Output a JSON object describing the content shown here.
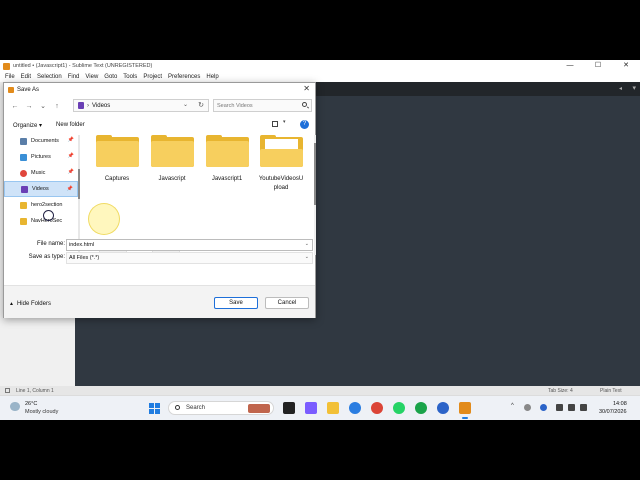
{
  "window": {
    "title": "untitled • (Javascript1) - Sublime Text (UNREGISTERED)",
    "minimize": "—",
    "maximize": "☐",
    "close": "✕"
  },
  "menu": [
    "File",
    "Edit",
    "Selection",
    "Find",
    "View",
    "Goto",
    "Tools",
    "Project",
    "Preferences",
    "Help"
  ],
  "tabbar": {
    "arrow": "◂",
    "menu": "▾"
  },
  "statusbar": {
    "position": "Line 1, Column 1",
    "tab_size": "Tab Size: 4",
    "syntax": "Plain Text"
  },
  "dialog": {
    "title": "Save As",
    "close": "✕",
    "nav": {
      "back": "←",
      "forward": "→",
      "recent": "⌄",
      "up": "↑"
    },
    "address": {
      "separator": "›",
      "location": "Videos",
      "dropdown": "⌄",
      "refresh": "↻"
    },
    "search": {
      "placeholder": "Search Videos"
    },
    "toolbar": {
      "organize": "Organize ▾",
      "new_folder": "New folder",
      "view_dropdown": "▾",
      "help": "?"
    },
    "nav_pane": [
      {
        "label": "Documents",
        "icon": "documents-icon",
        "color": "#5a7ea8",
        "pinned": true
      },
      {
        "label": "Pictures",
        "icon": "pictures-icon",
        "color": "#3a8fd6",
        "pinned": true
      },
      {
        "label": "Music",
        "icon": "music-icon",
        "color": "#e0463c",
        "pinned": true
      },
      {
        "label": "Videos",
        "icon": "videos-icon",
        "color": "#6a3fb5",
        "pinned": true,
        "selected": true
      },
      {
        "label": "hero2section",
        "icon": "folder-icon",
        "color": "#e8b530",
        "pinned": false
      },
      {
        "label": "NavHeroSec",
        "icon": "folder-icon",
        "color": "#e8b530",
        "pinned": false
      }
    ],
    "pin_glyph": "📌",
    "files": [
      {
        "name": "Captures"
      },
      {
        "name": "Javascript"
      },
      {
        "name": "Javascript1"
      },
      {
        "name": "YoutubeVideosUpload",
        "name_line1": "YoutubeVideosU",
        "name_line2": "pload"
      }
    ],
    "file_name": {
      "label": "File name:",
      "value": "index.html"
    },
    "save_as_type": {
      "label": "Save as type:",
      "value": "All Files (*.*)"
    },
    "hide_folders": "Hide Folders",
    "hide_caret": "▲",
    "save": "Save",
    "cancel": "Cancel"
  },
  "taskbar": {
    "weather": {
      "temp": "26°C",
      "desc": "Mostly cloudy"
    },
    "search_label": "Search",
    "apps": [
      {
        "name": "task-view-icon",
        "color": "#222"
      },
      {
        "name": "copilot-icon",
        "color": "#7a5cff"
      },
      {
        "name": "file-explorer-icon",
        "color": "#f2c037"
      },
      {
        "name": "store-icon",
        "color": "#2a7de1"
      },
      {
        "name": "edge-icon",
        "color": "#1b9ad6"
      },
      {
        "name": "chrome-icon",
        "color": "#db4437"
      },
      {
        "name": "whatsapp-icon",
        "color": "#25d366"
      },
      {
        "name": "green-app-icon",
        "color": "#1aa34a"
      },
      {
        "name": "blue-app-icon",
        "color": "#2b63c8"
      },
      {
        "name": "sublime-text-icon",
        "color": "#e28b1b",
        "active": true
      }
    ],
    "tray_chevron": "^",
    "clock": {
      "time": "14:08",
      "date": "30/07/2026"
    }
  }
}
